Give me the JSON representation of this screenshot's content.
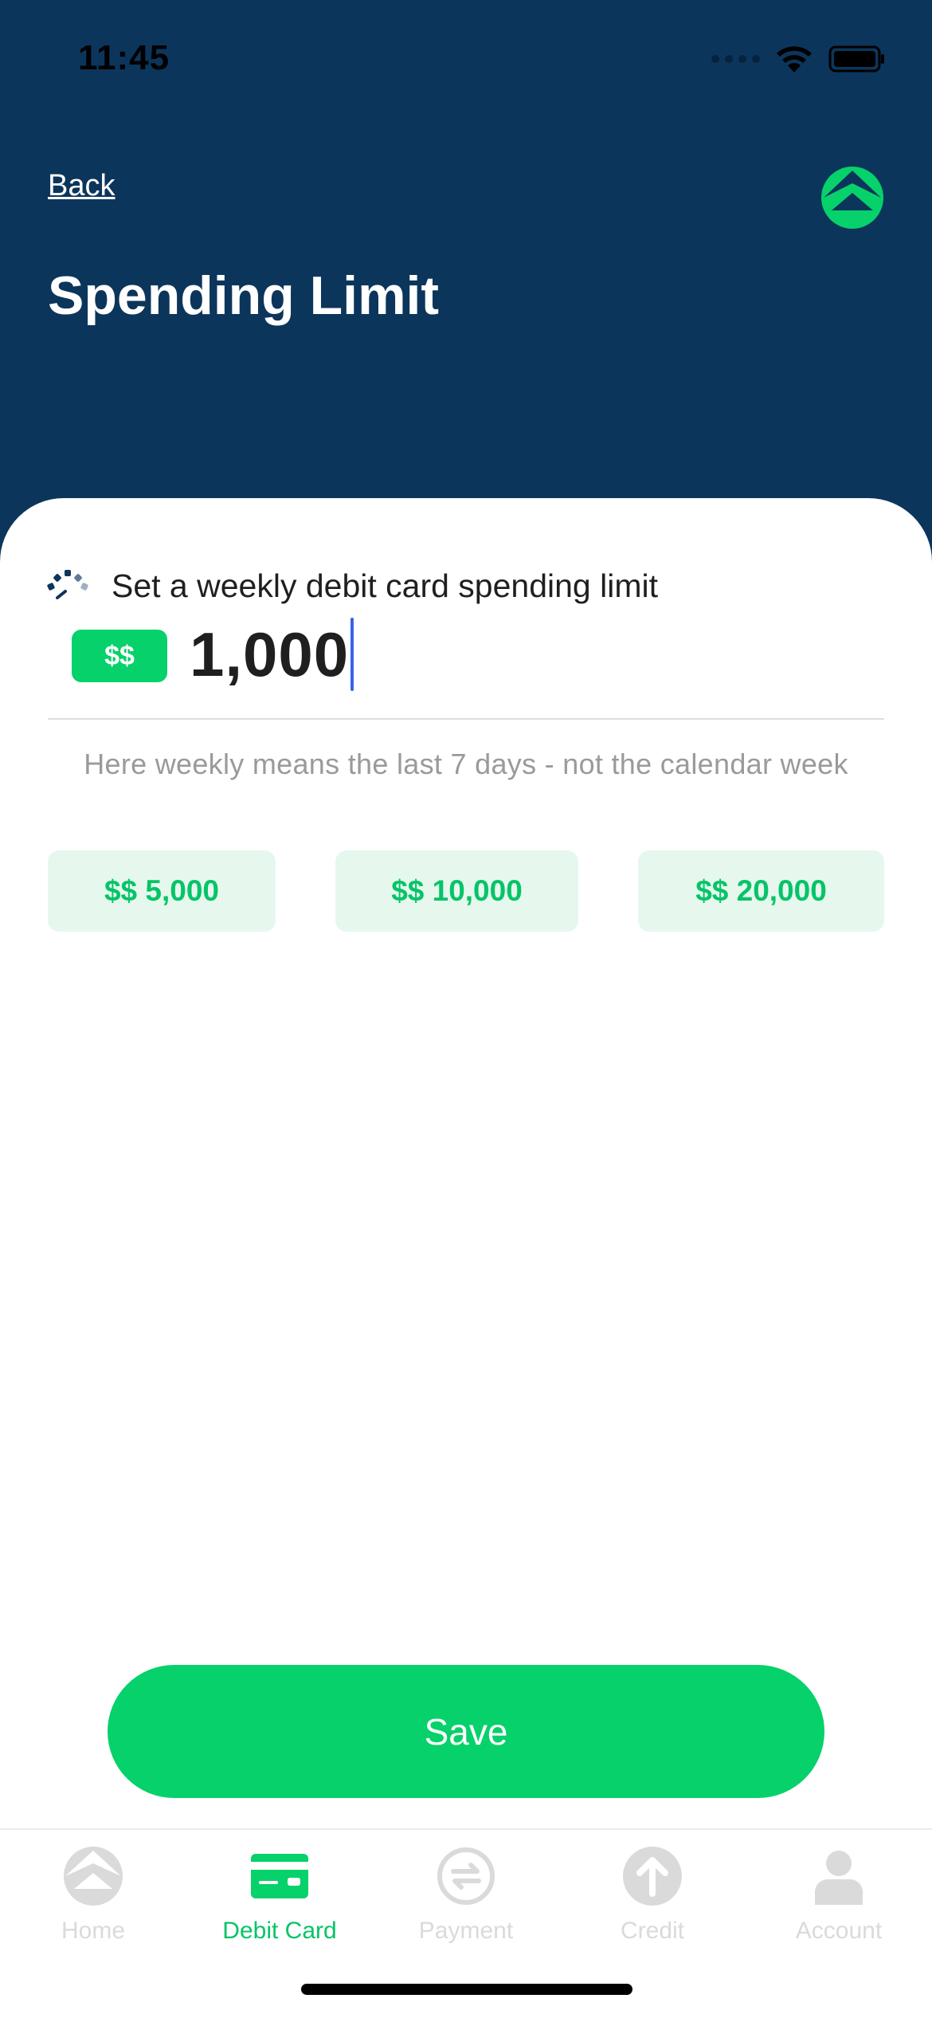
{
  "status_bar": {
    "time": "11:45"
  },
  "header": {
    "back_label": "Back",
    "title": "Spending Limit",
    "logo_icon": "brand-logo-icon"
  },
  "limit": {
    "label": "Set a weekly debit card spending limit",
    "currency_badge": "$$",
    "amount": "1,000",
    "hint": "Here weekly means the last 7 days - not the calendar week"
  },
  "presets": [
    "$$ 5,000",
    "$$ 10,000",
    "$$ 20,000"
  ],
  "save_label": "Save",
  "tabs": [
    {
      "label": "Home",
      "icon": "home-icon",
      "active": false
    },
    {
      "label": "Debit Card",
      "icon": "debit-card-icon",
      "active": true
    },
    {
      "label": "Payment",
      "icon": "payment-icon",
      "active": false
    },
    {
      "label": "Credit",
      "icon": "credit-icon",
      "active": false
    },
    {
      "label": "Account",
      "icon": "account-icon",
      "active": false
    }
  ],
  "colors": {
    "header_bg": "#0c355b",
    "accent_green": "#06d16a",
    "preset_bg": "#e6f8ee",
    "caret": "#3a63e8"
  }
}
